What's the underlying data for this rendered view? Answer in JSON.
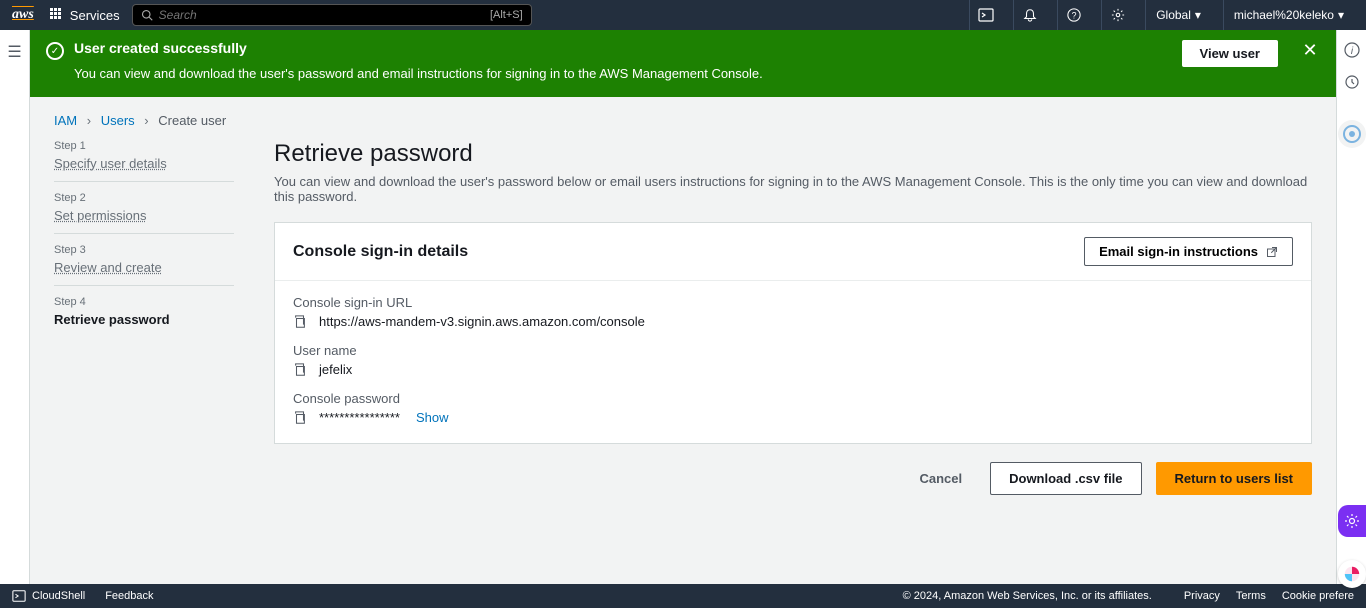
{
  "nav": {
    "services_label": "Services",
    "search_placeholder": "Search",
    "search_shortcut": "[Alt+S]",
    "region": "Global",
    "user": "michael%20keleko"
  },
  "banner": {
    "title": "User created successfully",
    "desc": "You can view and download the user's password and email instructions for signing in to the AWS Management Console.",
    "view_user_label": "View user"
  },
  "breadcrumb": {
    "iam": "IAM",
    "users": "Users",
    "create": "Create user"
  },
  "steps": [
    {
      "num": "Step 1",
      "name": "Specify user details"
    },
    {
      "num": "Step 2",
      "name": "Set permissions"
    },
    {
      "num": "Step 3",
      "name": "Review and create"
    },
    {
      "num": "Step 4",
      "name": "Retrieve password"
    }
  ],
  "page": {
    "title": "Retrieve password",
    "desc": "You can view and download the user's password below or email users instructions for signing in to the AWS Management Console. This is the only time you can view and download this password."
  },
  "card": {
    "title": "Console sign-in details",
    "email_btn": "Email sign-in instructions",
    "signin_url_label": "Console sign-in URL",
    "signin_url_value": "https://aws-mandem-v3.signin.aws.amazon.com/console",
    "username_label": "User name",
    "username_value": "jefelix",
    "password_label": "Console password",
    "password_mask": "****************",
    "show_label": "Show"
  },
  "actions": {
    "cancel": "Cancel",
    "download": "Download .csv file",
    "return": "Return to users list"
  },
  "footer": {
    "cloudshell": "CloudShell",
    "feedback": "Feedback",
    "copyright": "© 2024, Amazon Web Services, Inc. or its affiliates.",
    "privacy": "Privacy",
    "terms": "Terms",
    "cookie": "Cookie prefere"
  }
}
